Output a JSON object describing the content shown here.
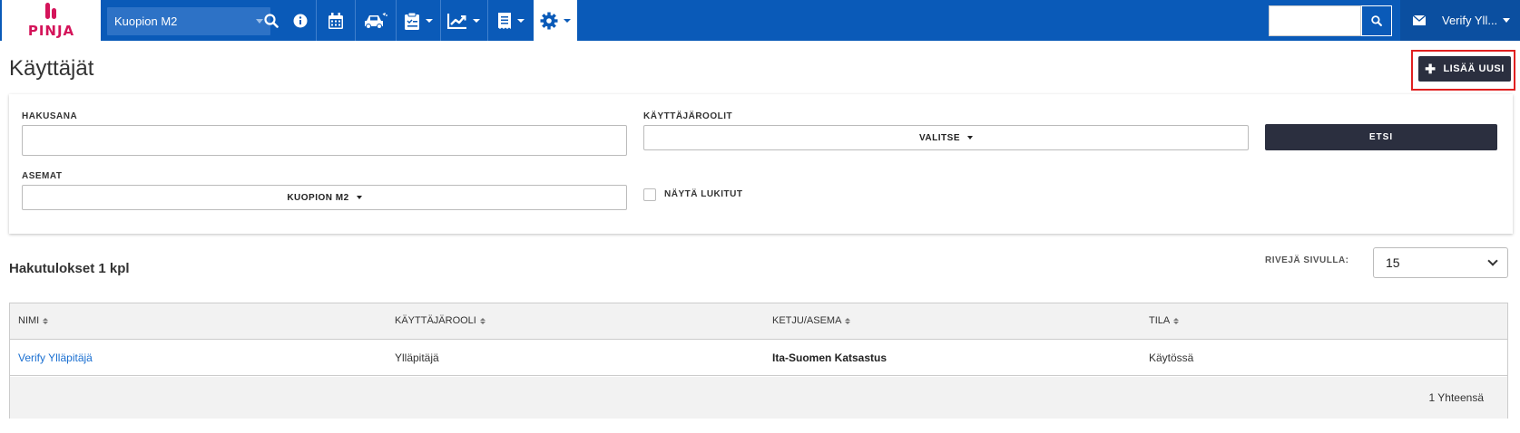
{
  "navbar": {
    "logo_text": "PINJA",
    "station": "Kuopion M2",
    "icons": [
      "search-icon",
      "info-icon",
      "calendar-icon",
      "car-icon",
      "clipboard-icon",
      "chart-icon",
      "receipt-icon",
      "gear-icon"
    ],
    "user_name": "Verify Yll...",
    "top_search_placeholder": ""
  },
  "page": {
    "title": "Käyttäjät",
    "add_button": "LISÄÄ UUSI"
  },
  "filters": {
    "hakusana_label": "HAKUSANA",
    "hakusana_value": "",
    "roles_label": "KÄYTTÄJÄROOLIT",
    "roles_select": "VALITSE",
    "search_button": "ETSI",
    "stations_label": "ASEMAT",
    "stations_select": "KUOPION M2",
    "show_locked_label": "NÄYTÄ LUKITUT",
    "show_locked_checked": false
  },
  "results": {
    "title": "Hakutulokset 1 kpl",
    "rows_per_page_label": "RIVEJÄ SIVULLA:",
    "rows_per_page": "15",
    "columns": [
      "NIMI",
      "KÄYTTÄJÄROOLI",
      "KETJU/ASEMA",
      "TILA"
    ],
    "rows": [
      {
        "nimi": "Verify Ylläpitäjä",
        "rooli": "Ylläpitäjä",
        "asema": "Ita-Suomen Katsastus",
        "tila": "Käytössä"
      }
    ],
    "total": "1 Yhteensä"
  }
}
